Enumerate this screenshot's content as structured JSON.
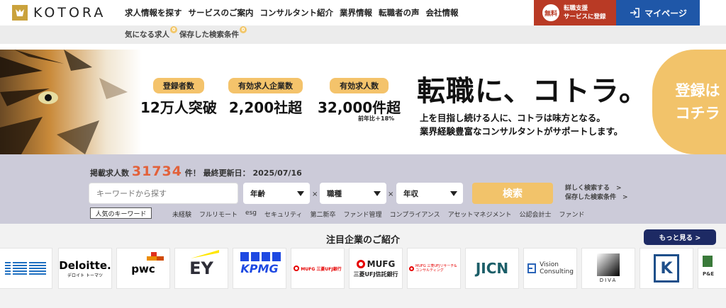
{
  "header": {
    "logo_text": "KOTORA",
    "nav": [
      "求人情報を探す",
      "サービスのご案内",
      "コンサルタント紹介",
      "業界情報",
      "転職者の声",
      "会社情報"
    ],
    "free_badge": "無料",
    "free_line1": "転職支援",
    "free_line2": "サービスに登録",
    "mypage": "マイページ",
    "brand_color": "#caa23c"
  },
  "subnav": {
    "items": [
      {
        "label": "気になる求人",
        "count": "0"
      },
      {
        "label": "保存した検索条件",
        "count": "0"
      }
    ]
  },
  "hero": {
    "stats": [
      {
        "label": "登録者数",
        "value": "12万人突破"
      },
      {
        "label": "有効求人企業数",
        "value": "2,200社超"
      },
      {
        "label": "有効求人数",
        "value": "32,000件超"
      }
    ],
    "stat_note": "前年比＋18%",
    "catch": "転職に、コトラ。",
    "catch_sub1": "上を目指し続ける人に、コトラは味方となる。",
    "catch_sub2": "業界経験豊富なコンサルタントがサポートします。",
    "register_line1": "登録は",
    "register_line2": "コチラ"
  },
  "search": {
    "count_prefix": "掲載求人数",
    "count_value": "31734",
    "count_suffix": "件！ 最終更新日：",
    "updated": "2025/07/16",
    "keyword_placeholder": "キーワードから探す",
    "selects": [
      "年齢",
      "職種",
      "年収"
    ],
    "times": "×",
    "button": "検索",
    "detail_link": "詳しく検索する　>",
    "saved_link": "保存した検索条件　>",
    "popular_label": "人気のキーワード",
    "popular_keywords": [
      "未経験",
      "フルリモート",
      "esg",
      "セキュリティ",
      "第二新卒",
      "ファンド管理",
      "コンプライアンス",
      "アセットマネジメント",
      "公認会計士",
      "ファンド"
    ]
  },
  "featured": {
    "title": "注目企業のご紹介",
    "more": "もっと見る >",
    "logos": [
      {
        "name": "IBM",
        "text": "IBM",
        "color": "#1f70c1"
      },
      {
        "name": "Deloitte",
        "text": "Deloitte.",
        "sub": "デロイト トーマツ",
        "color": "#000000"
      },
      {
        "name": "pwc",
        "text": "pwc",
        "color": "#d04a02"
      },
      {
        "name": "EY",
        "text": "EY",
        "color": "#2e2e38"
      },
      {
        "name": "KPMG",
        "text": "KPMG",
        "color": "#1e49e2"
      },
      {
        "name": "MUFG Bank",
        "text": "MUFG 三菱UFJ銀行",
        "color": "#e60000"
      },
      {
        "name": "MUFG Trust",
        "text": "MUFG",
        "sub": "三菱UFJ信託銀行",
        "color": "#e60000"
      },
      {
        "name": "MUFG Research",
        "text": "MUFG 三菱UFJリサーチ&コンサルティング",
        "color": "#e60000"
      },
      {
        "name": "JICN",
        "text": "JICN",
        "color": "#1b5e68"
      },
      {
        "name": "Vision Consulting",
        "text": "Vision",
        "sub": "Consulting",
        "color": "#2a64b8"
      },
      {
        "name": "DIVA",
        "text": "DIVA",
        "color": "#111111"
      },
      {
        "name": "K",
        "text": "K",
        "color": "#1e4f8a"
      },
      {
        "name": "P&E",
        "text": "P&E",
        "color": "#3a7a3a"
      }
    ]
  }
}
